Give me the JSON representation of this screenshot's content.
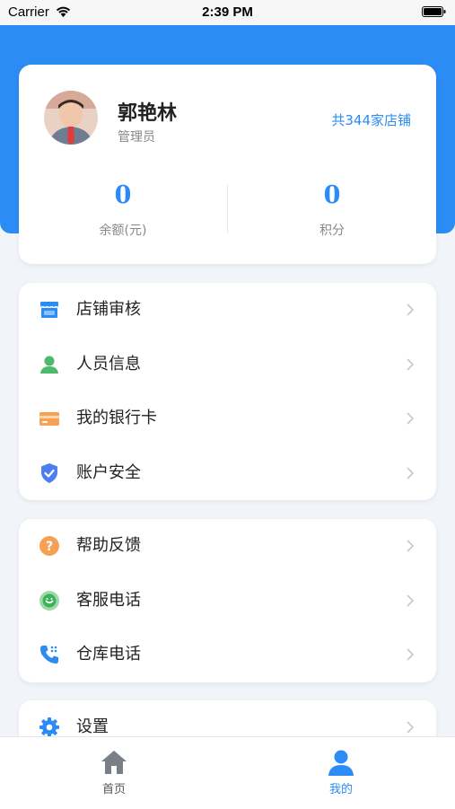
{
  "status_bar": {
    "carrier": "Carrier",
    "time": "2:39 PM"
  },
  "profile": {
    "name": "郭艳林",
    "role": "管理员",
    "store_count": "共344家店铺",
    "balance": {
      "value": "0",
      "label": "余额(元)"
    },
    "points": {
      "value": "0",
      "label": "积分"
    }
  },
  "menu_group_1": [
    {
      "label": "店铺审核",
      "icon": "store-icon"
    },
    {
      "label": "人员信息",
      "icon": "person-icon"
    },
    {
      "label": "我的银行卡",
      "icon": "bank-card-icon"
    },
    {
      "label": "账户安全",
      "icon": "shield-icon"
    }
  ],
  "menu_group_2": [
    {
      "label": "帮助反馈",
      "icon": "help-icon"
    },
    {
      "label": "客服电话",
      "icon": "customer-service-icon"
    },
    {
      "label": "仓库电话",
      "icon": "phone-icon"
    }
  ],
  "menu_group_3": [
    {
      "label": "设置",
      "icon": "gear-icon"
    }
  ],
  "tabbar": {
    "home": {
      "label": "首页",
      "active": false
    },
    "mine": {
      "label": "我的",
      "active": true
    }
  },
  "colors": {
    "primary": "#2b8cf5",
    "background": "#f1f4f9",
    "inactive_tab": "#7a7f86"
  }
}
